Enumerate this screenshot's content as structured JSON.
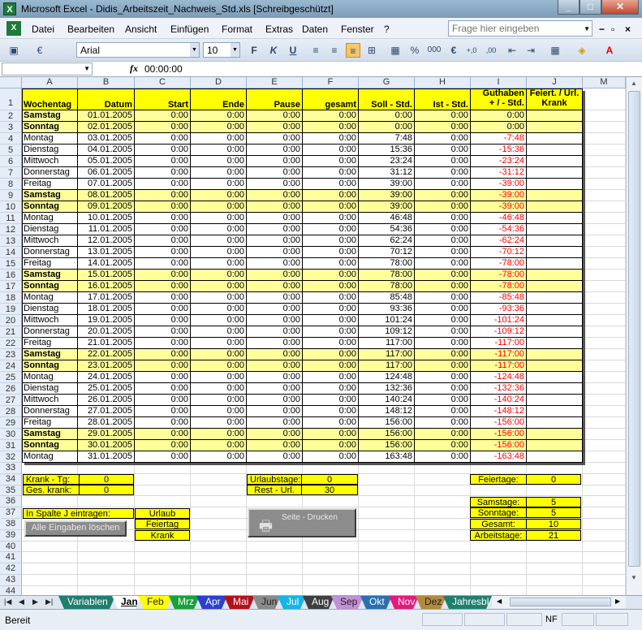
{
  "window": {
    "title": "Microsoft Excel - Didis_Arbeitszeit_Nachweis_Std.xls  [Schreibgeschützt]",
    "app_glyph": "X"
  },
  "menu": {
    "items": [
      "Datei",
      "Bearbeiten",
      "Ansicht",
      "Einfügen",
      "Format",
      "Extras",
      "Daten",
      "Fenster",
      "?"
    ],
    "help_placeholder": "Frage hier eingeben"
  },
  "toolbar": {
    "font": "Arial",
    "size": "10"
  },
  "formula_bar": {
    "name_box": "",
    "value": "00:00:00"
  },
  "columns": [
    "A",
    "B",
    "C",
    "D",
    "E",
    "F",
    "G",
    "H",
    "I",
    "J",
    "M"
  ],
  "headers": {
    "a": "Wochentag",
    "b": "Datum",
    "c": "Start",
    "d": "Ende",
    "e": "Pause",
    "f": "gesamt",
    "g": "Soll - Std.",
    "h": "Ist - Std.",
    "i1": "Guthaben",
    "i2": "+ / - Std.",
    "j1": "Feiert. / Url.",
    "j2": "Krank"
  },
  "rows": [
    {
      "day": "Samstag",
      "date": "01.01.2005",
      "soll": "0:00",
      "guthaben": "0:00",
      "we": true
    },
    {
      "day": "Sonntag",
      "date": "02.01.2005",
      "soll": "0:00",
      "guthaben": "0:00",
      "we": true
    },
    {
      "day": "Montag",
      "date": "03.01.2005",
      "soll": "7:48",
      "guthaben": "-7:48",
      "we": false
    },
    {
      "day": "Dienstag",
      "date": "04.01.2005",
      "soll": "15:36",
      "guthaben": "-15:36",
      "we": false
    },
    {
      "day": "Mittwoch",
      "date": "05.01.2005",
      "soll": "23:24",
      "guthaben": "-23:24",
      "we": false
    },
    {
      "day": "Donnerstag",
      "date": "06.01.2005",
      "soll": "31:12",
      "guthaben": "-31:12",
      "we": false
    },
    {
      "day": "Freitag",
      "date": "07.01.2005",
      "soll": "39:00",
      "guthaben": "-39:00",
      "we": false
    },
    {
      "day": "Samstag",
      "date": "08.01.2005",
      "soll": "39:00",
      "guthaben": "-39:00",
      "we": true
    },
    {
      "day": "Sonntag",
      "date": "09.01.2005",
      "soll": "39:00",
      "guthaben": "-39:00",
      "we": true
    },
    {
      "day": "Montag",
      "date": "10.01.2005",
      "soll": "46:48",
      "guthaben": "-46:48",
      "we": false
    },
    {
      "day": "Dienstag",
      "date": "11.01.2005",
      "soll": "54:36",
      "guthaben": "-54:36",
      "we": false
    },
    {
      "day": "Mittwoch",
      "date": "12.01.2005",
      "soll": "62:24",
      "guthaben": "-62:24",
      "we": false
    },
    {
      "day": "Donnerstag",
      "date": "13.01.2005",
      "soll": "70:12",
      "guthaben": "-70:12",
      "we": false
    },
    {
      "day": "Freitag",
      "date": "14.01.2005",
      "soll": "78:00",
      "guthaben": "-78:00",
      "we": false
    },
    {
      "day": "Samstag",
      "date": "15.01.2005",
      "soll": "78:00",
      "guthaben": "-78:00",
      "we": true
    },
    {
      "day": "Sonntag",
      "date": "16.01.2005",
      "soll": "78:00",
      "guthaben": "-78:00",
      "we": true
    },
    {
      "day": "Montag",
      "date": "17.01.2005",
      "soll": "85:48",
      "guthaben": "-85:48",
      "we": false
    },
    {
      "day": "Dienstag",
      "date": "18.01.2005",
      "soll": "93:36",
      "guthaben": "-93:36",
      "we": false
    },
    {
      "day": "Mittwoch",
      "date": "19.01.2005",
      "soll": "101:24",
      "guthaben": "-101:24",
      "we": false
    },
    {
      "day": "Donnerstag",
      "date": "20.01.2005",
      "soll": "109:12",
      "guthaben": "-109:12",
      "we": false
    },
    {
      "day": "Freitag",
      "date": "21.01.2005",
      "soll": "117:00",
      "guthaben": "-117:00",
      "we": false
    },
    {
      "day": "Samstag",
      "date": "22.01.2005",
      "soll": "117:00",
      "guthaben": "-117:00",
      "we": true
    },
    {
      "day": "Sonntag",
      "date": "23.01.2005",
      "soll": "117:00",
      "guthaben": "-117:00",
      "we": true
    },
    {
      "day": "Montag",
      "date": "24.01.2005",
      "soll": "124:48",
      "guthaben": "-124:48",
      "we": false
    },
    {
      "day": "Dienstag",
      "date": "25.01.2005",
      "soll": "132:36",
      "guthaben": "-132:36",
      "we": false
    },
    {
      "day": "Mittwoch",
      "date": "26.01.2005",
      "soll": "140:24",
      "guthaben": "-140:24",
      "we": false
    },
    {
      "day": "Donnerstag",
      "date": "27.01.2005",
      "soll": "148:12",
      "guthaben": "-148:12",
      "we": false
    },
    {
      "day": "Freitag",
      "date": "28.01.2005",
      "soll": "156:00",
      "guthaben": "-156:00",
      "we": false
    },
    {
      "day": "Samstag",
      "date": "29.01.2005",
      "soll": "156:00",
      "guthaben": "-156:00",
      "we": true
    },
    {
      "day": "Sonntag",
      "date": "30.01.2005",
      "soll": "156:00",
      "guthaben": "-156:00",
      "we": true
    },
    {
      "day": "Montag",
      "date": "31.01.2005",
      "soll": "163:48",
      "guthaben": "-163:48",
      "we": false
    }
  ],
  "zero_time": "0:00",
  "row_numbers": [
    "1",
    "2",
    "3",
    "4",
    "5",
    "6",
    "7",
    "8",
    "9",
    "10",
    "11",
    "12",
    "13",
    "14",
    "15",
    "16",
    "17",
    "18",
    "19",
    "20",
    "21",
    "22",
    "23",
    "24",
    "25",
    "26",
    "27",
    "28",
    "29",
    "30",
    "31",
    "32",
    "33",
    "34",
    "35",
    "36",
    "37",
    "38",
    "39",
    "40",
    "41",
    "42",
    "43",
    "44"
  ],
  "summary": {
    "krank_label": "Krank - Tg:",
    "krank_value": "0",
    "ges_krank_label": "Ges. krank:",
    "ges_krank_value": "0",
    "urlaub_label": "Urlaubstage:",
    "urlaub_value": "0",
    "rest_label": "Rest - Url.",
    "rest_value": "30",
    "feiertage_label": "Feiertage:",
    "feiertage_value": "0",
    "samstage_label": "Samstage:",
    "samstage_value": "5",
    "sonntage_label": "Sonntage:",
    "sonntage_value": "5",
    "gesamt_label": "Gesamt:",
    "gesamt_value": "10",
    "arbeitstage_label": "Arbeitstage:",
    "arbeitstage_value": "21",
    "eintragen_label": "In Spalte   J  eintragen:",
    "code_urlaub": "Urlaub",
    "code_feiertag": "Feiertag",
    "code_krank": "Krank",
    "clear_button": "Alle Eingaben löschen",
    "print_button": "Seite - Drucken"
  },
  "sheet_tabs": [
    {
      "label": "Variablen",
      "color": "#1f7f6f"
    },
    {
      "label": "Jan",
      "color": "#ffffff"
    },
    {
      "label": "Feb",
      "color": "#ffff00"
    },
    {
      "label": "Mrz",
      "color": "#17a33a"
    },
    {
      "label": "Apr",
      "color": "#2b3fcf"
    },
    {
      "label": "Mai",
      "color": "#b3121b"
    },
    {
      "label": "Jun",
      "color": "#8a8a8a"
    },
    {
      "label": "Jul",
      "color": "#17b4e6"
    },
    {
      "label": "Aug",
      "color": "#3f3f3f"
    },
    {
      "label": "Sep",
      "color": "#c38fd6"
    },
    {
      "label": "Okt",
      "color": "#2a6fb0"
    },
    {
      "label": "Nov",
      "color": "#e6197d"
    },
    {
      "label": "Dez",
      "color": "#b38a3c"
    },
    {
      "label": "Jahresbl",
      "color": "#1f7f6f"
    }
  ],
  "status": {
    "text": "Bereit",
    "nf": "NF"
  }
}
